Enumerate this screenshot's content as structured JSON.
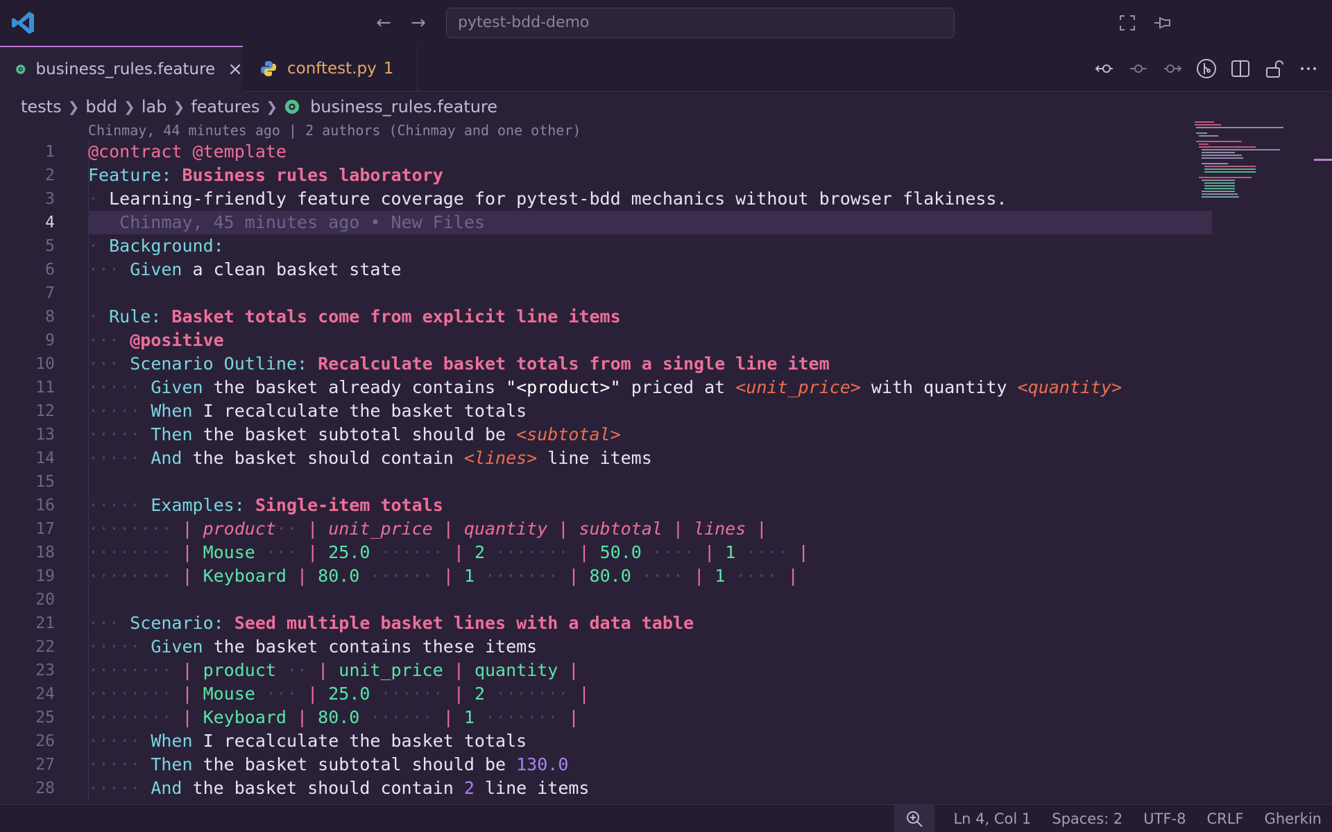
{
  "titlebar": {
    "search_text": "pytest-bdd-demo"
  },
  "tabs": [
    {
      "label": "business_rules.feature",
      "icon": "gherkin-icon",
      "active": true
    },
    {
      "label": "conftest.py",
      "badge": "1",
      "icon": "python-icon",
      "active": false
    }
  ],
  "breadcrumb": [
    "tests",
    "bdd",
    "lab",
    "features",
    "business_rules.feature"
  ],
  "blame_header": "Chinmay, 44 minutes ago | 2 authors (Chinmay and one other)",
  "inline_blame": "Chinmay, 45 minutes ago • New Files",
  "line_numbers": [
    "1",
    "2",
    "3",
    "4",
    "5",
    "6",
    "7",
    "8",
    "9",
    "10",
    "11",
    "12",
    "13",
    "14",
    "15",
    "16",
    "17",
    "18",
    "19",
    "20",
    "21",
    "22",
    "23",
    "24",
    "25",
    "26",
    "27",
    "28"
  ],
  "current_line": 4,
  "code": {
    "l1": "@contract @template",
    "l2_kw": "Feature:",
    "l2_title": " Business rules laboratory",
    "l3": "Learning-friendly feature coverage for pytest-bdd mechanics without browser flakiness.",
    "l5": "Background:",
    "l6_kw": "Given",
    "l6_txt": " a clean basket state",
    "l8_kw": "Rule:",
    "l8_title": " Basket totals come from explicit line items",
    "l9": "@positive",
    "l10_kw": "Scenario Outline:",
    "l10_title": " Recalculate basket totals from a single line item",
    "l11_kw": "Given",
    "l11_a": " the basket already contains ",
    "l11_str": "\"<product>\"",
    "l11_b": " priced at ",
    "l11_ph1": "<unit_price>",
    "l11_c": " with quantity ",
    "l11_ph2": "<quantity>",
    "l12_kw": "When",
    "l12_txt": " I recalculate the basket totals",
    "l13_kw": "Then",
    "l13_txt": " the basket subtotal should be ",
    "l13_ph": "<subtotal>",
    "l14_kw": "And",
    "l14_a": " the basket should contain ",
    "l14_ph": "<lines>",
    "l14_b": " line items",
    "l16_kw": "Examples:",
    "l16_title": " Single-item totals",
    "examples_headers": [
      "product",
      "unit_price",
      "quantity",
      "subtotal",
      "lines"
    ],
    "examples_rows": [
      [
        "Mouse",
        "25.0",
        "2",
        "50.0",
        "1"
      ],
      [
        "Keyboard",
        "80.0",
        "1",
        "80.0",
        "1"
      ]
    ],
    "l21_kw": "Scenario:",
    "l21_title": " Seed multiple basket lines with a data table",
    "l22_kw": "Given",
    "l22_txt": " the basket contains these items",
    "table_headers": [
      "product",
      "unit_price",
      "quantity"
    ],
    "table_rows": [
      [
        "Mouse",
        "25.0",
        "2"
      ],
      [
        "Keyboard",
        "80.0",
        "1"
      ]
    ],
    "l26_kw": "When",
    "l26_txt": " I recalculate the basket totals",
    "l27_kw": "Then",
    "l27_txt": " the basket subtotal should be ",
    "l27_num": "130.0",
    "l28_kw": "And",
    "l28_a": " the basket should contain ",
    "l28_num": "2",
    "l28_b": " line items"
  },
  "statusbar": {
    "position": "Ln 4, Col 1",
    "spaces": "Spaces: 2",
    "encoding": "UTF-8",
    "eol": "CRLF",
    "language": "Gherkin"
  },
  "colors": {
    "background": "#2a2138",
    "keyword": "#78d6e0",
    "title": "#ef6f98",
    "placeholder": "#ee6f4f",
    "cell": "#59e6a6",
    "number": "#a684f0",
    "accent": "#b87ad8"
  }
}
